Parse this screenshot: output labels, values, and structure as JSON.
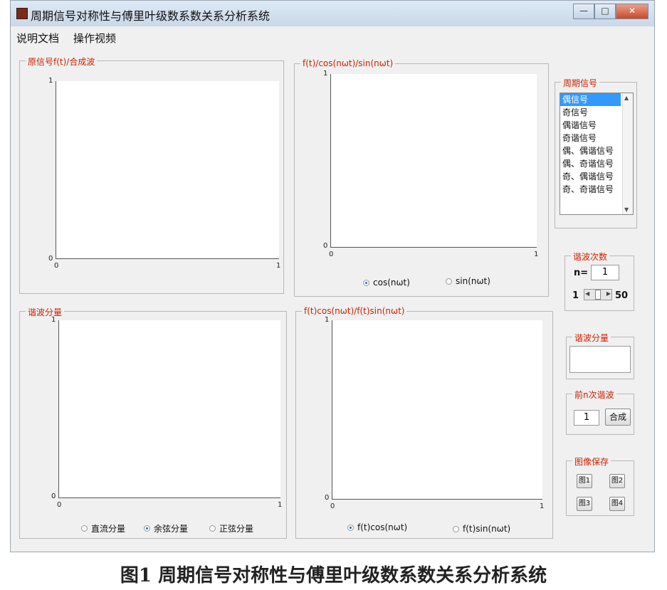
{
  "window": {
    "title": "周期信号对称性与傅里叶级数系数关系分析系统",
    "buttons": {
      "minimize": "—",
      "maximize": "□",
      "close": "✕"
    }
  },
  "menu": {
    "items": [
      "说明文档",
      "操作视频"
    ]
  },
  "panels": {
    "original_signal": {
      "title": "原信号f(t)/合成波",
      "axis": {
        "y_top": "1",
        "y_bottom": "0",
        "x_left": "0",
        "x_right": "1"
      }
    },
    "basis": {
      "title": "f(t)/cos(nωt)/sin(nωt)",
      "axis": {
        "y_top": "1",
        "y_bottom": "0",
        "x_left": "0",
        "x_right": "1"
      },
      "radios": [
        {
          "label": "cos(nωt)",
          "selected": true
        },
        {
          "label": "sin(nωt)",
          "selected": false
        }
      ]
    },
    "harmonic": {
      "title": "谐波分量",
      "axis": {
        "y_top": "1",
        "y_bottom": "0",
        "x_left": "0",
        "x_right": "1"
      },
      "radios": [
        {
          "label": "直流分量",
          "selected": false
        },
        {
          "label": "余弦分量",
          "selected": true
        },
        {
          "label": "正弦分量",
          "selected": false
        }
      ]
    },
    "product": {
      "title": "f(t)cos(nωt)/f(t)sin(nωt)",
      "axis": {
        "y_top": "1",
        "y_bottom": "0",
        "x_left": "0",
        "x_right": "1"
      },
      "radios": [
        {
          "label": "f(t)cos(nωt)",
          "selected": true
        },
        {
          "label": "f(t)sin(nωt)",
          "selected": false
        }
      ]
    }
  },
  "periodic_signal": {
    "title": "周期信号",
    "options": [
      "偶信号",
      "奇信号",
      "偶谐信号",
      "奇谐信号",
      "偶、偶谐信号",
      "偶、奇谐信号",
      "奇、偶谐信号",
      "奇、奇谐信号"
    ],
    "selected": "偶信号"
  },
  "harmonic_order": {
    "title": "谐波次数",
    "n_label": "n=",
    "n_value": "1",
    "slider_min": "1",
    "slider_max": "50"
  },
  "harmonic_component": {
    "title": "谐波分量",
    "value": ""
  },
  "first_n": {
    "title": "前n次谐波",
    "value": "1",
    "button": "合成"
  },
  "image_save": {
    "title": "图像保存",
    "buttons": [
      "图1",
      "图2",
      "图3",
      "图4"
    ]
  },
  "caption": "图1  周期信号对称性与傅里叶级数系数关系分析系统",
  "colors": {
    "legend": "#cc2200",
    "selection": "#3399ff",
    "radio_selected": "#2a6ab0"
  }
}
